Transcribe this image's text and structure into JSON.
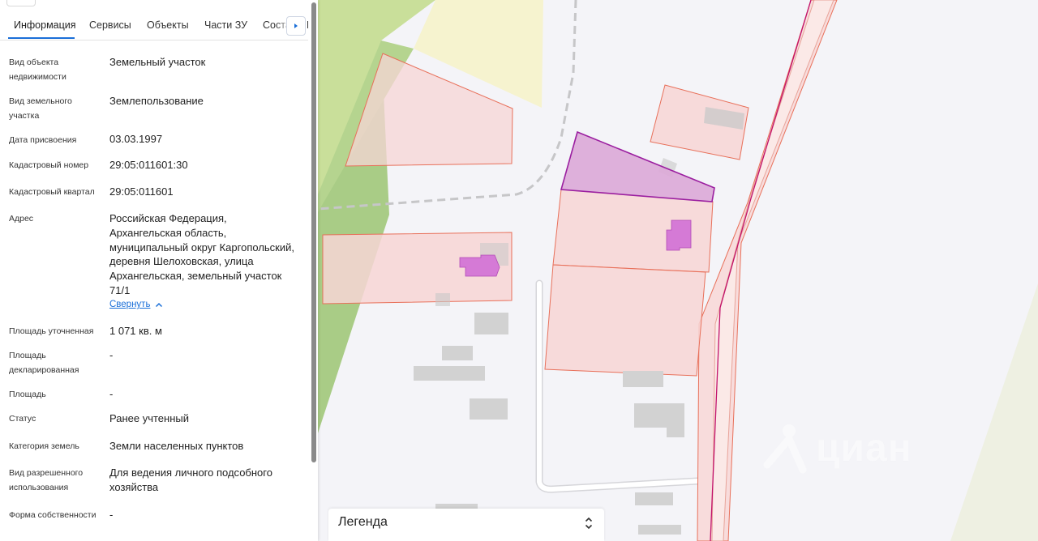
{
  "tabs": [
    {
      "label": "Информация"
    },
    {
      "label": "Сервисы"
    },
    {
      "label": "Объекты"
    },
    {
      "label": "Части ЗУ"
    },
    {
      "label": "Состав"
    },
    {
      "label": "Г"
    }
  ],
  "info": {
    "object_type": {
      "label": "Вид объекта недвижимости",
      "value": "Земельный участок"
    },
    "plot_type": {
      "label": "Вид земельного участка",
      "value": "Землепользование"
    },
    "assigned_date": {
      "label": "Дата присвоения",
      "value": "03.03.1997"
    },
    "cadastral_no": {
      "label": "Кадастровый номер",
      "value": "29:05:011601:30"
    },
    "quarter": {
      "label": "Кадастровый квартал",
      "value": "29:05:011601"
    },
    "address": {
      "label": "Адрес",
      "value": "Российская Федерация, Архангельская область, муниципальный округ Каргопольский, деревня Шелоховская, улица Архангельская, земельный участок 71/1",
      "collapse_link": "Свернуть"
    },
    "area_refined": {
      "label": "Площадь уточненная",
      "value": "1 071 кв. м"
    },
    "area_declared": {
      "label": "Площадь декларированная",
      "value": "-"
    },
    "area": {
      "label": "Площадь",
      "value": "-"
    },
    "status": {
      "label": "Статус",
      "value": "Ранее учтенный"
    },
    "land_category": {
      "label": "Категория земель",
      "value": "Земли населенных пунктов"
    },
    "permitted_use": {
      "label": "Вид разрешенного использования",
      "value": "Для ведения личного подсобного хозяйства"
    },
    "ownership": {
      "label": "Форма собственности",
      "value": "-"
    }
  },
  "legend": {
    "title": "Легенда"
  },
  "watermark": {
    "text": "циан"
  },
  "colors": {
    "accent": "#1a6fd8",
    "parcel_fill": "#f7d5d5",
    "parcel_stroke": "#e8705a",
    "selected_fill": "#dba9d7",
    "selected_stroke": "#9b1fa0",
    "building_selected": "#d57ad6",
    "forest": "#a9cc86"
  }
}
